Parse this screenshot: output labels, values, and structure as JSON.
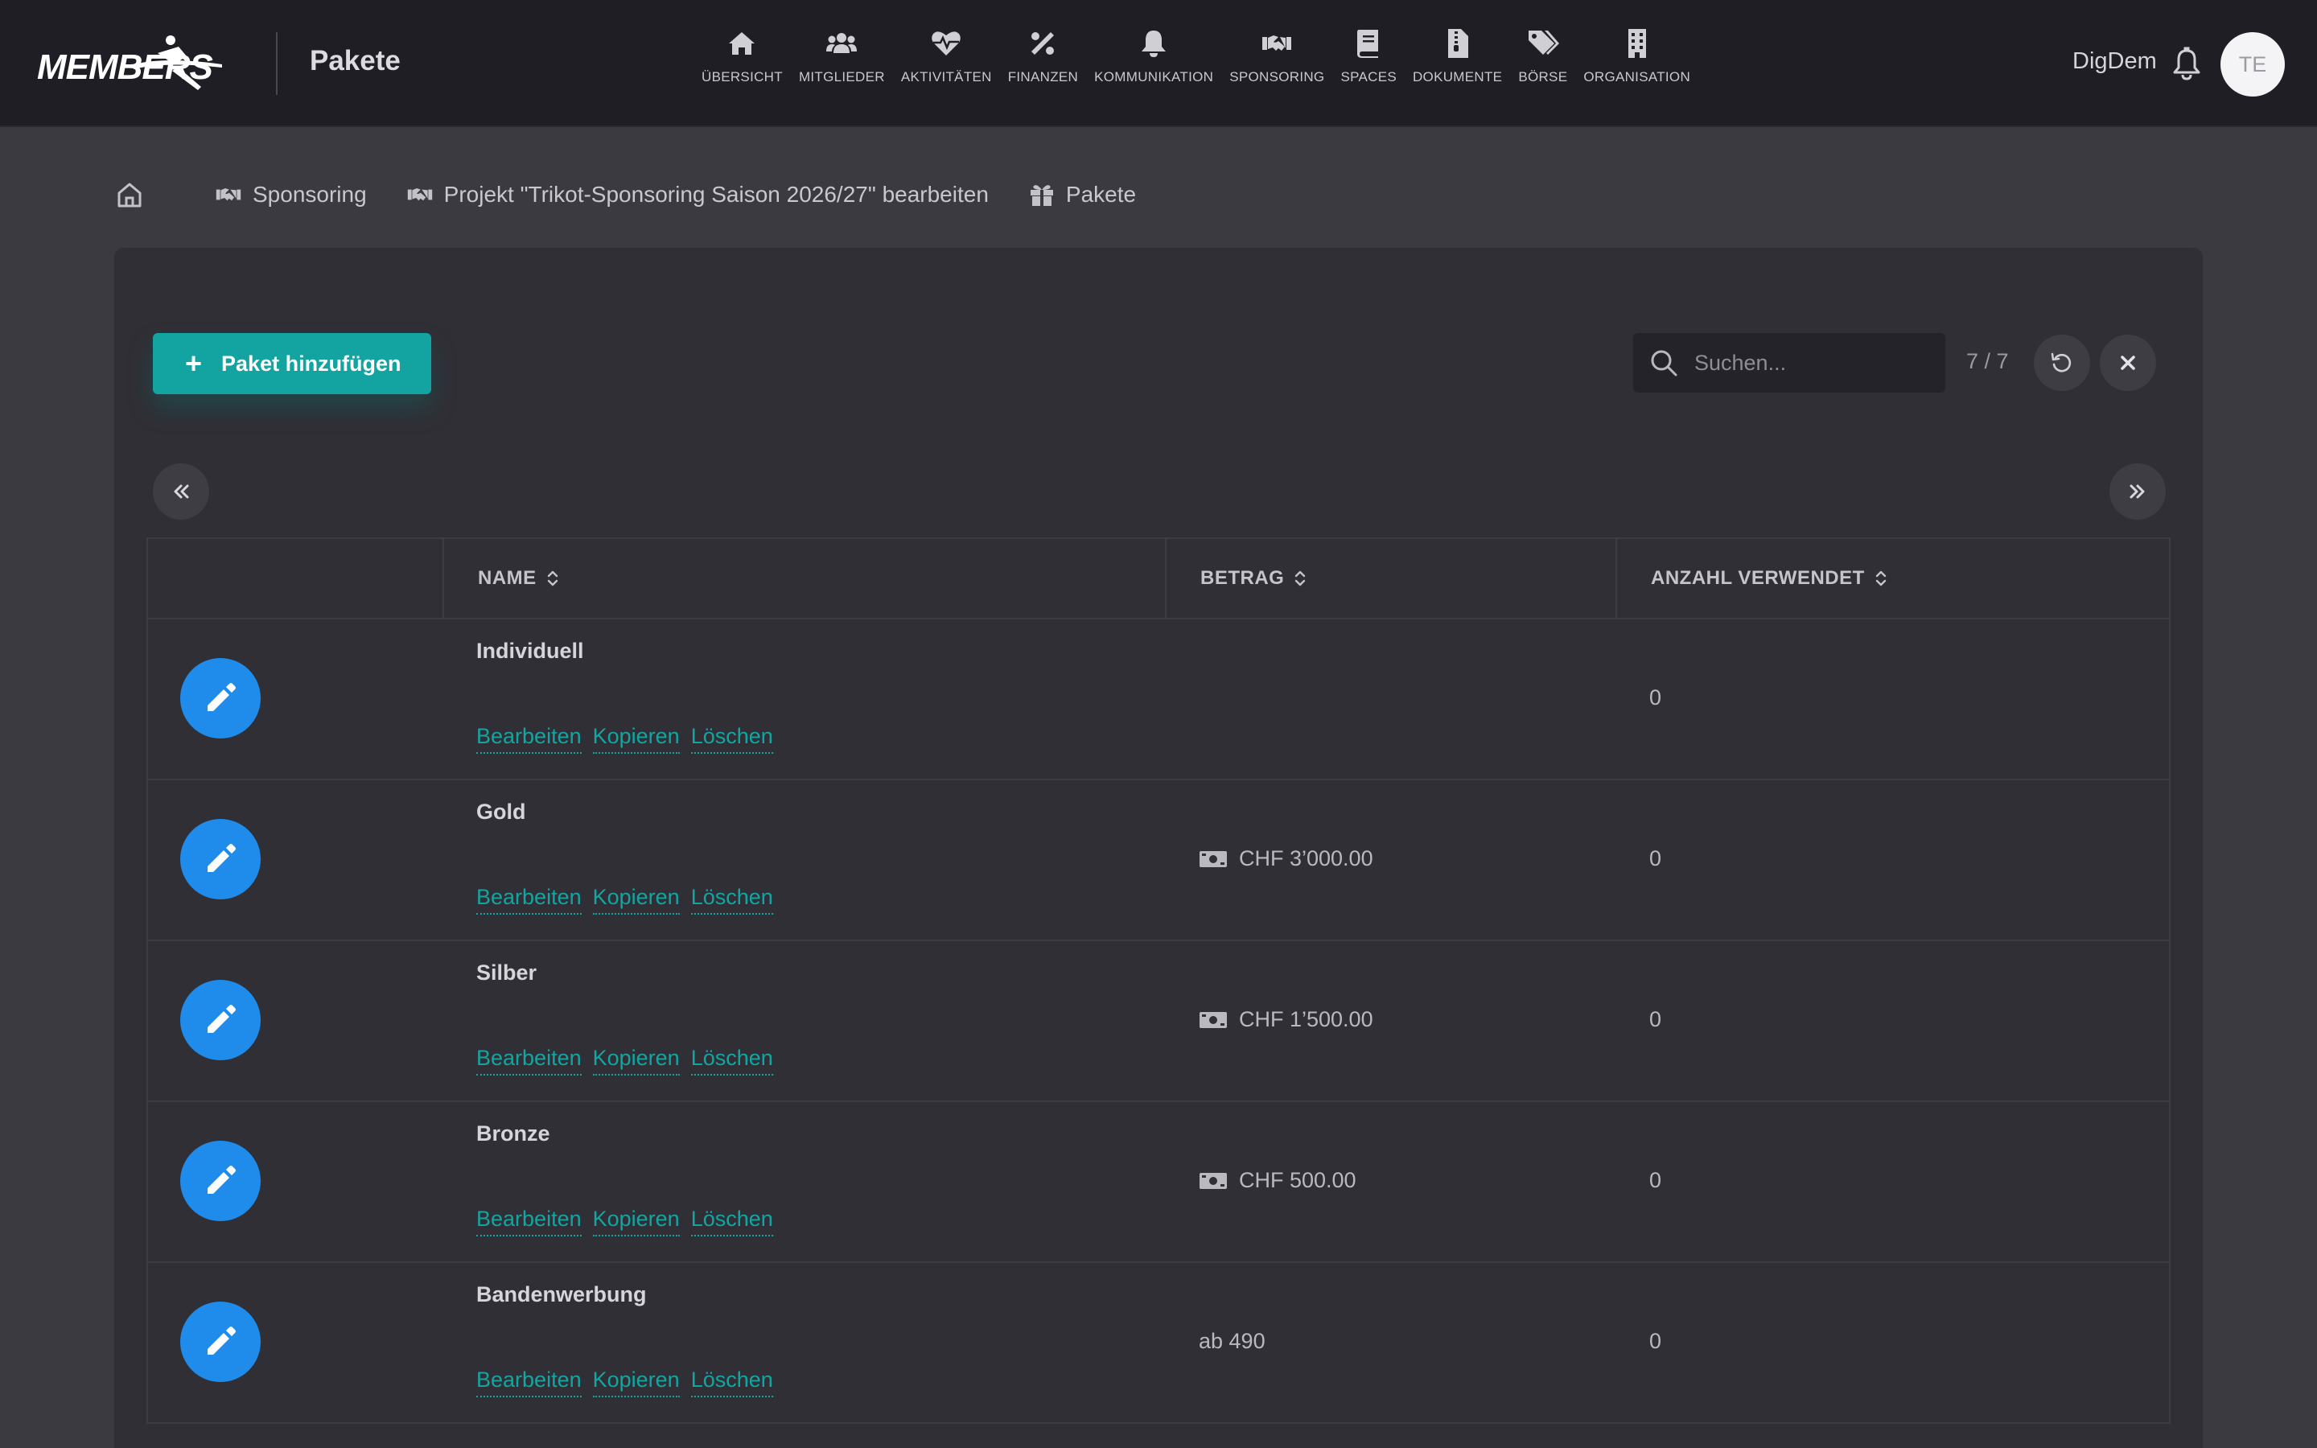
{
  "app": {
    "logo_text": "MEMBERS",
    "page_title": "Pakete",
    "user_name": "DigDem",
    "avatar_initials": "TE"
  },
  "nav": [
    {
      "icon": "home-icon",
      "label": "ÜBERSICHT"
    },
    {
      "icon": "users-icon",
      "label": "MITGLIEDER"
    },
    {
      "icon": "heartbeat-icon",
      "label": "AKTIVITÄTEN"
    },
    {
      "icon": "percent-icon",
      "label": "FINANZEN"
    },
    {
      "icon": "bell-icon",
      "label": "KOMMUNIKATION"
    },
    {
      "icon": "handshake-icon",
      "label": "SPONSORING"
    },
    {
      "icon": "book-icon",
      "label": "SPACES"
    },
    {
      "icon": "file-zip-icon",
      "label": "DOKUMENTE"
    },
    {
      "icon": "tags-icon",
      "label": "BÖRSE"
    },
    {
      "icon": "building-icon",
      "label": "ORGANISATION"
    }
  ],
  "breadcrumb": [
    {
      "icon": "handshake-icon",
      "label": "Sponsoring"
    },
    {
      "icon": "handshake-icon",
      "label": "Projekt \"Trikot-Sponsoring Saison 2026/27\" bearbeiten"
    },
    {
      "icon": "gift-icon",
      "label": "Pakete"
    }
  ],
  "toolbar": {
    "add_label": "Paket hinzufügen",
    "search_placeholder": "Suchen...",
    "count": "7 / 7"
  },
  "table": {
    "headers": {
      "name": "NAME",
      "betrag": "BETRAG",
      "anzahl": "ANZAHL VERWENDET"
    },
    "action_labels": {
      "edit": "Bearbeiten",
      "copy": "Kopieren",
      "delete": "Löschen"
    },
    "rows": [
      {
        "name": "Individuell",
        "betrag": "",
        "betrag_money_icon": false,
        "anzahl": "0"
      },
      {
        "name": "Gold",
        "betrag": "CHF 3’000.00",
        "betrag_money_icon": true,
        "anzahl": "0"
      },
      {
        "name": "Silber",
        "betrag": "CHF 1’500.00",
        "betrag_money_icon": true,
        "anzahl": "0"
      },
      {
        "name": "Bronze",
        "betrag": "CHF 500.00",
        "betrag_money_icon": true,
        "anzahl": "0"
      },
      {
        "name": "Bandenwerbung",
        "betrag": "ab 490",
        "betrag_money_icon": false,
        "anzahl": "0"
      }
    ]
  },
  "colors": {
    "primary_teal": "#13a3a1",
    "edit_blue": "#1f8ceb",
    "topbar_bg": "#1f1e24",
    "card_bg": "#302f35"
  }
}
